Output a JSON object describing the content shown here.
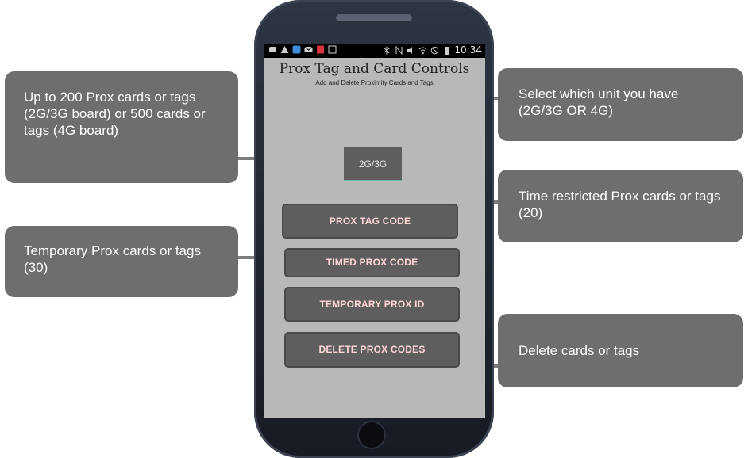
{
  "statusbar": {
    "time": "10:34",
    "icons_left": [
      "message-icon",
      "warning-icon",
      "app-icon",
      "mail-icon",
      "pdf-icon",
      "image-icon"
    ],
    "icons_right": [
      "bluetooth-icon",
      "nfc-icon",
      "mute-icon",
      "wifi-icon",
      "blocked-icon",
      "battery-icon"
    ]
  },
  "app": {
    "title": "Prox Tag and Card Controls",
    "subtitle": "Add and Delete Proximity Cards and Tags",
    "unit_select_value": "2G/3G",
    "buttons": {
      "prox_tag_code": "PROX TAG CODE",
      "timed_prox_code": "TIMED PROX CODE",
      "temporary_prox_id": "TEMPORARY PROX ID",
      "delete_prox_codes": "DELETE PROX CODES"
    }
  },
  "callouts": {
    "prox_cards": "Up to 200 Prox cards or tags (2G/3G board) or 500 cards or tags (4G board)",
    "temporary": "Temporary Prox cards or tags (30)",
    "select_unit": "Select which unit you have (2G/3G OR 4G)",
    "time_restricted": "Time restricted Prox cards or tags (20)",
    "delete": "Delete cards or tags"
  },
  "colors": {
    "callout_bg": "#6e6e6e",
    "screen_bg": "#b8b8b8",
    "button_bg": "#5e5e5e",
    "button_text": "#ffd6d6",
    "phone_body": "#2e3542"
  }
}
